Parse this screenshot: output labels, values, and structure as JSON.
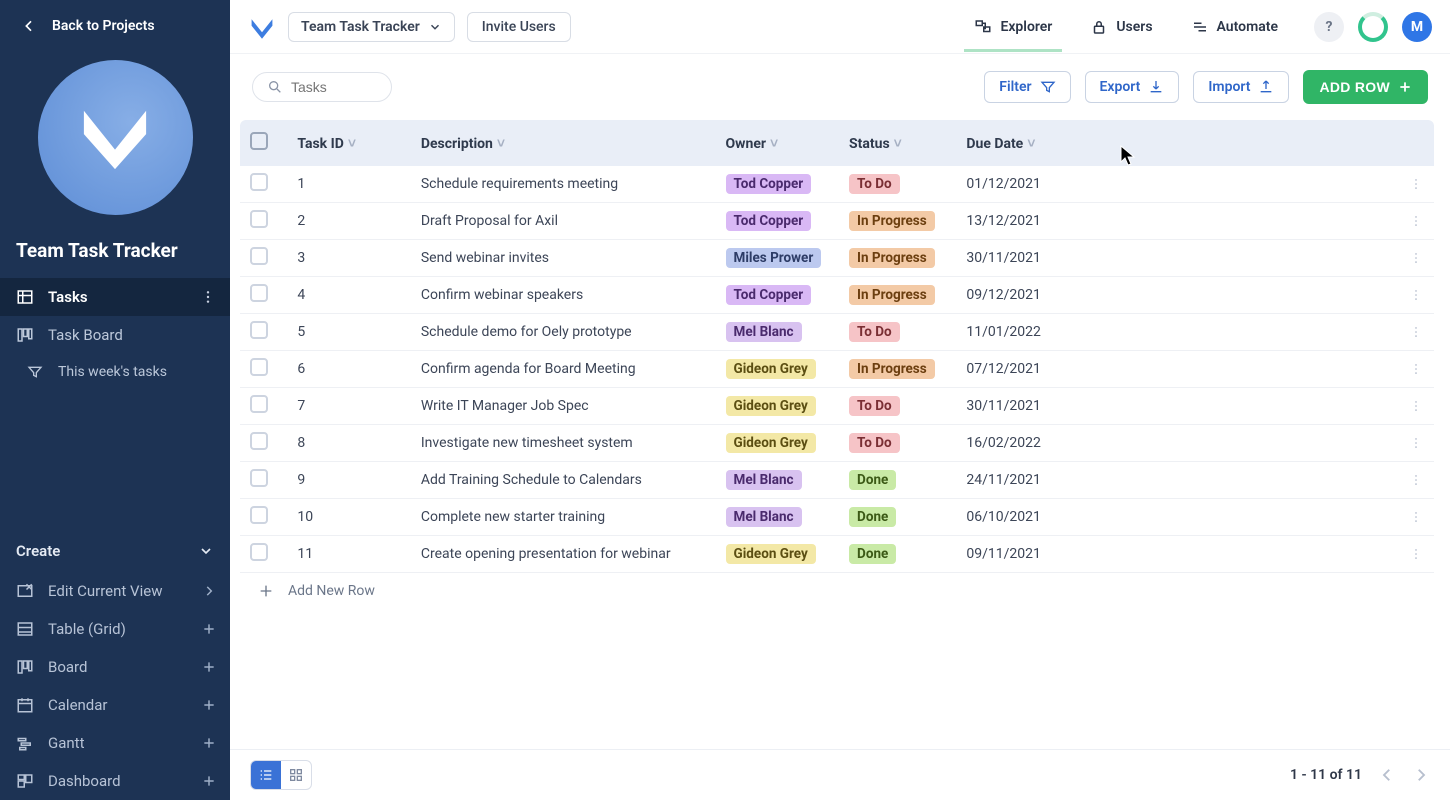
{
  "sidebar": {
    "back": "Back to Projects",
    "project": "Team Task Tracker",
    "nav": [
      {
        "label": "Tasks",
        "active": true
      },
      {
        "label": "Task Board"
      },
      {
        "label": "This week's tasks",
        "filter": true
      }
    ],
    "create_header": "Create",
    "create_items": [
      {
        "label": "Edit Current View",
        "chevron": true
      },
      {
        "label": "Table (Grid)"
      },
      {
        "label": "Board"
      },
      {
        "label": "Calendar"
      },
      {
        "label": "Gantt"
      },
      {
        "label": "Dashboard"
      }
    ]
  },
  "topbar": {
    "project": "Team Task Tracker",
    "invite": "Invite Users",
    "nav": [
      {
        "label": "Explorer",
        "active": true,
        "icon": "explorer"
      },
      {
        "label": "Users",
        "icon": "lock"
      },
      {
        "label": "Automate",
        "icon": "automate"
      }
    ],
    "avatar": "M"
  },
  "toolbar": {
    "search_placeholder": "Tasks",
    "filter": "Filter",
    "export": "Export",
    "import": "Import",
    "add_row": "ADD ROW"
  },
  "columns": [
    "Task ID",
    "Description",
    "Owner",
    "Status",
    "Due Date"
  ],
  "owners_style": {
    "Tod Copper": "tod",
    "Miles Prower": "miles",
    "Mel Blanc": "mel",
    "Gideon Grey": "gideon"
  },
  "status_style": {
    "To Do": "todo",
    "In Progress": "inprog",
    "Done": "done"
  },
  "rows": [
    {
      "id": "1",
      "desc": "Schedule requirements meeting",
      "owner": "Tod Copper",
      "status": "To Do",
      "date": "01/12/2021"
    },
    {
      "id": "2",
      "desc": "Draft Proposal for Axil",
      "owner": "Tod Copper",
      "status": "In Progress",
      "date": "13/12/2021"
    },
    {
      "id": "3",
      "desc": "Send webinar invites",
      "owner": "Miles Prower",
      "status": "In Progress",
      "date": "30/11/2021"
    },
    {
      "id": "4",
      "desc": "Confirm webinar speakers",
      "owner": "Tod Copper",
      "status": "In Progress",
      "date": "09/12/2021"
    },
    {
      "id": "5",
      "desc": "Schedule demo for Oely prototype",
      "owner": "Mel Blanc",
      "status": "To Do",
      "date": "11/01/2022"
    },
    {
      "id": "6",
      "desc": "Confirm agenda for Board Meeting",
      "owner": "Gideon Grey",
      "status": "In Progress",
      "date": "07/12/2021"
    },
    {
      "id": "7",
      "desc": "Write IT Manager Job Spec",
      "owner": "Gideon Grey",
      "status": "To Do",
      "date": "30/11/2021"
    },
    {
      "id": "8",
      "desc": "Investigate new timesheet system",
      "owner": "Gideon Grey",
      "status": "To Do",
      "date": "16/02/2022"
    },
    {
      "id": "9",
      "desc": "Add Training Schedule to Calendars",
      "owner": "Mel Blanc",
      "status": "Done",
      "date": "24/11/2021"
    },
    {
      "id": "10",
      "desc": "Complete new starter training",
      "owner": "Mel Blanc",
      "status": "Done",
      "date": "06/10/2021"
    },
    {
      "id": "11",
      "desc": "Create opening presentation for webinar",
      "owner": "Gideon Grey",
      "status": "Done",
      "date": "09/11/2021"
    }
  ],
  "add_row_label": "Add New Row",
  "footer": {
    "range": "1 - 11 of 11"
  }
}
